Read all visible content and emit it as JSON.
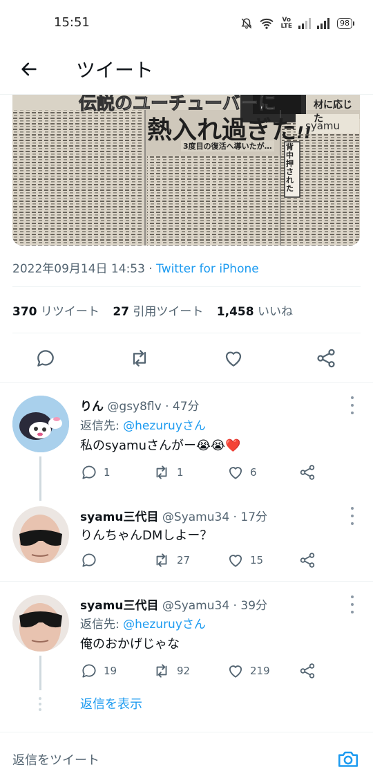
{
  "status_bar": {
    "time": "15:51",
    "volte_top": "Vo",
    "volte_bottom": "LTE",
    "battery": "98"
  },
  "header": {
    "title": "ツイート"
  },
  "media": {
    "headline": "熱入れ過ぎた",
    "headline_mark": "!!",
    "headline_top": "伝説のユーチューバーに",
    "byline": "syamu",
    "subhead": "3度目の復活へ導いたが…",
    "sidebox": "背中押された",
    "right_edge": "材に応じた"
  },
  "tweet": {
    "timestamp": "2022年09月14日 14:53",
    "separator": " · ",
    "client": "Twitter for iPhone",
    "stats": [
      {
        "count": "370",
        "label": "リツイート"
      },
      {
        "count": "27",
        "label": "引用ツイート"
      },
      {
        "count": "1,458",
        "label": "いいね"
      }
    ]
  },
  "replies": [
    {
      "name": "りん",
      "handle": "@gsy8flv",
      "time": "47分",
      "reply_prefix": "返信先: ",
      "reply_to": "@hezuruyさん",
      "text": "私のsyamuさんがー😭😭❤️",
      "counts": {
        "reply": "1",
        "retweet": "1",
        "like": "6"
      }
    },
    {
      "name": "syamu三代目",
      "handle": "@Syamu34",
      "time": "17分",
      "text": "りんちゃんDMしよー？",
      "counts": {
        "reply": "",
        "retweet": "27",
        "like": "15"
      }
    },
    {
      "name": "syamu三代目",
      "handle": "@Syamu34",
      "time": "39分",
      "reply_prefix": "返信先: ",
      "reply_to": "@hezuruyさん",
      "text": "俺のおかげじゃな",
      "counts": {
        "reply": "19",
        "retweet": "92",
        "like": "219"
      }
    }
  ],
  "show_replies": "返信を表示",
  "compose": {
    "placeholder": "返信をツイート"
  },
  "colors": {
    "accent": "#1d9bf0",
    "text": "#0f1419",
    "muted": "#536471",
    "heart": "#e0245e"
  },
  "icons": [
    "back-arrow-icon",
    "reply-icon",
    "retweet-icon",
    "like-icon",
    "share-icon",
    "more-icon",
    "camera-icon",
    "bell-mute-icon",
    "wifi-icon",
    "signal-icon",
    "battery-icon"
  ]
}
